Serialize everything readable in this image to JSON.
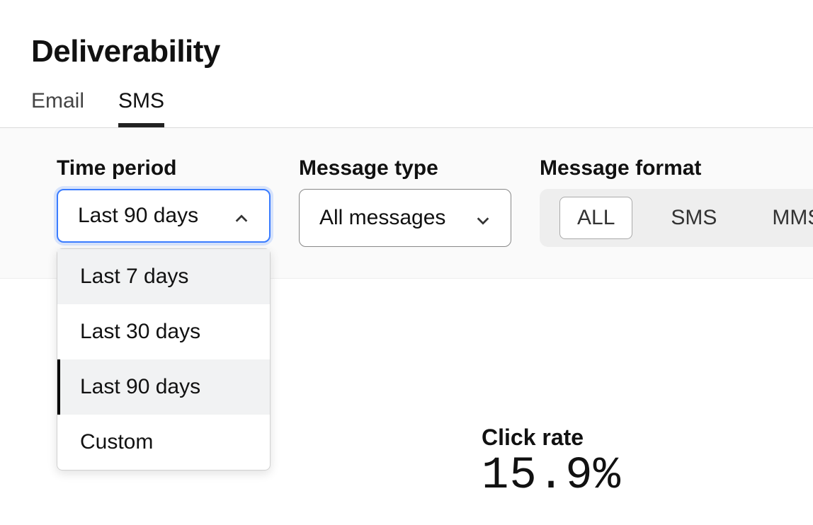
{
  "title": "Deliverability",
  "tabs": {
    "email": "Email",
    "sms": "SMS",
    "active": "SMS"
  },
  "filters": {
    "time_period": {
      "label": "Time period",
      "selected": "Last 90 days",
      "expanded": true,
      "options": [
        "Last 7 days",
        "Last 30 days",
        "Last 90 days",
        "Custom"
      ],
      "hovered": "Last 7 days"
    },
    "message_type": {
      "label": "Message type",
      "selected": "All messages"
    },
    "message_format": {
      "label": "Message format",
      "selected": "ALL",
      "options": [
        "ALL",
        "SMS",
        "MMS"
      ]
    }
  },
  "metrics": {
    "click_rate": {
      "label": "Click rate",
      "value": "15.9%"
    }
  }
}
